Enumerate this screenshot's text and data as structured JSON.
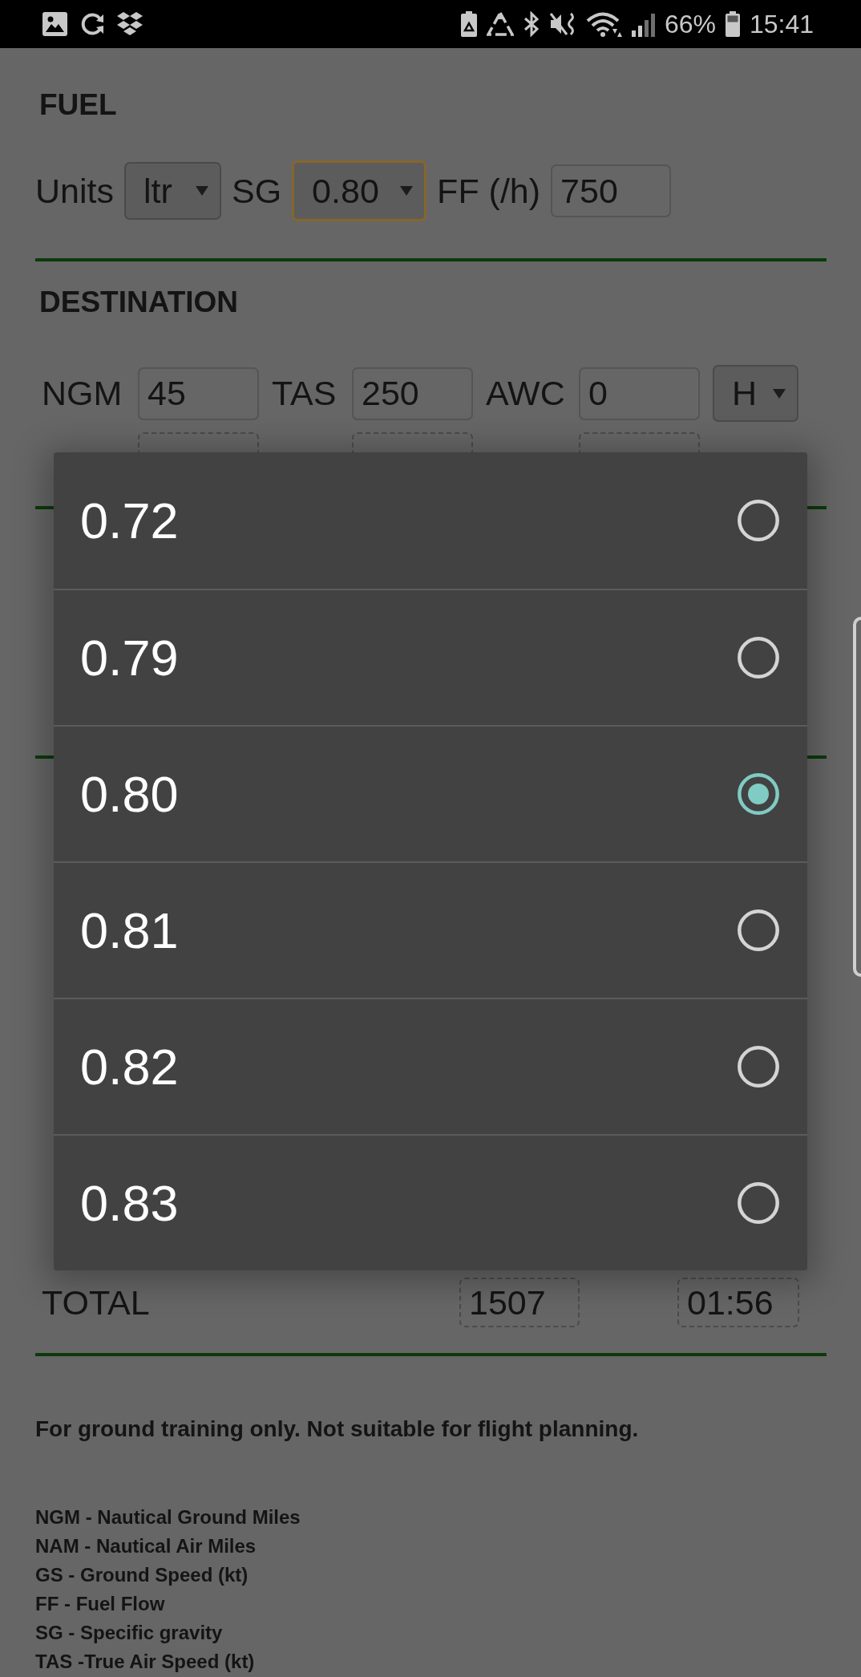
{
  "status_bar": {
    "battery": "66%",
    "time": "15:41"
  },
  "fuel": {
    "title": "FUEL",
    "fields": [
      {
        "kind": "select",
        "label": "Units",
        "value": "ltr",
        "focused": false
      },
      {
        "kind": "select",
        "label": "SG",
        "value": "0.80",
        "focused": true
      },
      {
        "kind": "input",
        "label": "FF (/h)",
        "value": "750",
        "focused": false
      }
    ]
  },
  "destination": {
    "title": "DESTINATION",
    "rows": [
      {
        "fields": [
          {
            "kind": "input",
            "label": "NGM",
            "value": "45"
          },
          {
            "kind": "input",
            "label": "TAS",
            "value": "250"
          },
          {
            "kind": "input",
            "label": "AWC",
            "value": "0",
            "dropdown": "H"
          }
        ]
      },
      {
        "fields": [
          {
            "kind": "output"
          },
          {
            "kind": "output"
          },
          {
            "kind": "output"
          }
        ]
      }
    ]
  },
  "fuel_summary": {
    "total": {
      "label": "TOTAL",
      "fuel": "1507",
      "time": "01:56"
    }
  },
  "disclaimer": "For ground training only. Not suitable for flight planning.",
  "glossary": [
    "NGM - Nautical Ground Miles",
    "NAM - Nautical Air Miles",
    "GS - Ground Speed (kt)",
    "FF - Fuel Flow",
    "SG - Specific gravity",
    "TAS -True Air Speed (kt)"
  ],
  "sg_picker": {
    "options": [
      {
        "label": "0.72",
        "selected": false
      },
      {
        "label": "0.79",
        "selected": false
      },
      {
        "label": "0.80",
        "selected": true
      },
      {
        "label": "0.81",
        "selected": false
      },
      {
        "label": "0.82",
        "selected": false
      },
      {
        "label": "0.83",
        "selected": false
      }
    ]
  }
}
